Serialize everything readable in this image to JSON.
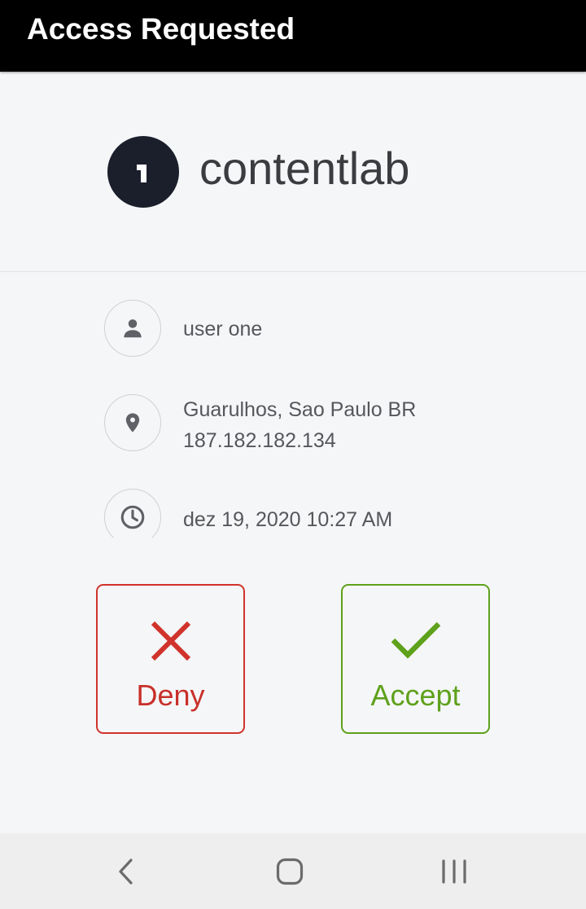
{
  "appbar": {
    "title": "Access Requested"
  },
  "brand": {
    "logo_icon": "onelogin-logo-icon",
    "logo_glyph": "1",
    "name": "contentlab"
  },
  "details": {
    "user": {
      "icon": "person-icon",
      "name": "user one"
    },
    "location": {
      "icon": "location-pin-icon",
      "place": "Guarulhos, Sao Paulo BR",
      "ip": "187.182.182.134"
    },
    "time": {
      "icon": "clock-icon",
      "timestamp": "dez 19, 2020 10:27 AM"
    }
  },
  "actions": {
    "deny": {
      "label": "Deny",
      "icon": "close-icon",
      "color": "#d0332b"
    },
    "accept": {
      "label": "Accept",
      "icon": "check-icon",
      "color": "#5ea11b"
    }
  },
  "navbar": {
    "back_icon": "back-chevron-icon",
    "home_icon": "home-icon",
    "recents_icon": "recent-apps-icon"
  },
  "colors": {
    "appbar_background": "#000000",
    "page_background": "#f5f6f8",
    "text_primary": "#3b3c3f",
    "text_secondary": "#55575b"
  }
}
